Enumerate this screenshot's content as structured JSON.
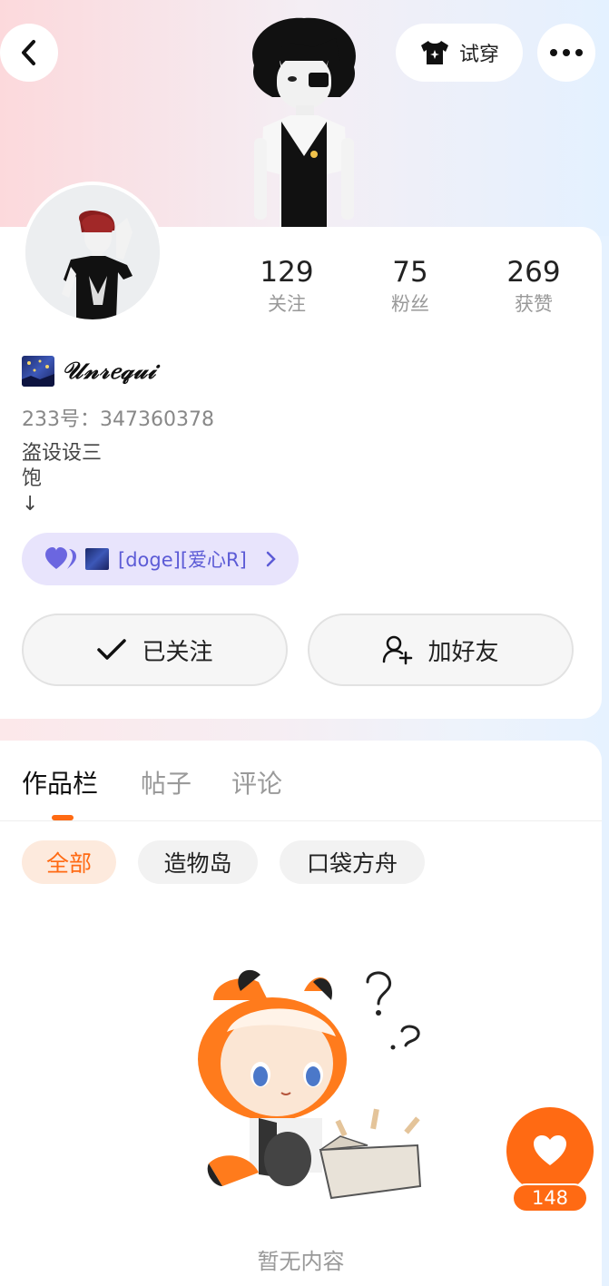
{
  "header": {
    "back_icon": "chevron-left-icon",
    "tryon_label": "试穿",
    "tryon_icon": "tshirt-sparkle-icon",
    "more_icon": "more-dots-icon"
  },
  "profile": {
    "stats": [
      {
        "value": "129",
        "label": "关注"
      },
      {
        "value": "75",
        "label": "粉丝"
      },
      {
        "value": "269",
        "label": "获赞"
      }
    ],
    "nickname": "𝒰𝓃𝓇𝑒𝓆𝓊𝒾",
    "uid": "233号：347360378",
    "bio_lines": [
      "盗设设三",
      "饱",
      "↓"
    ],
    "badge_text": "[doge][爱心R]",
    "follow_label": "已关注",
    "add_friend_label": "加好友"
  },
  "tabs": [
    {
      "label": "作品栏",
      "active": true
    },
    {
      "label": "帖子",
      "active": false
    },
    {
      "label": "评论",
      "active": false
    }
  ],
  "filters": [
    {
      "label": "全部",
      "active": true
    },
    {
      "label": "造物岛",
      "active": false
    },
    {
      "label": "口袋方舟",
      "active": false
    }
  ],
  "empty_state": {
    "text": "暂无内容"
  },
  "like": {
    "count": "148"
  },
  "colors": {
    "accent": "#ff6a13",
    "badge_bg": "#e8e4fc",
    "badge_text": "#5c5bd6"
  }
}
